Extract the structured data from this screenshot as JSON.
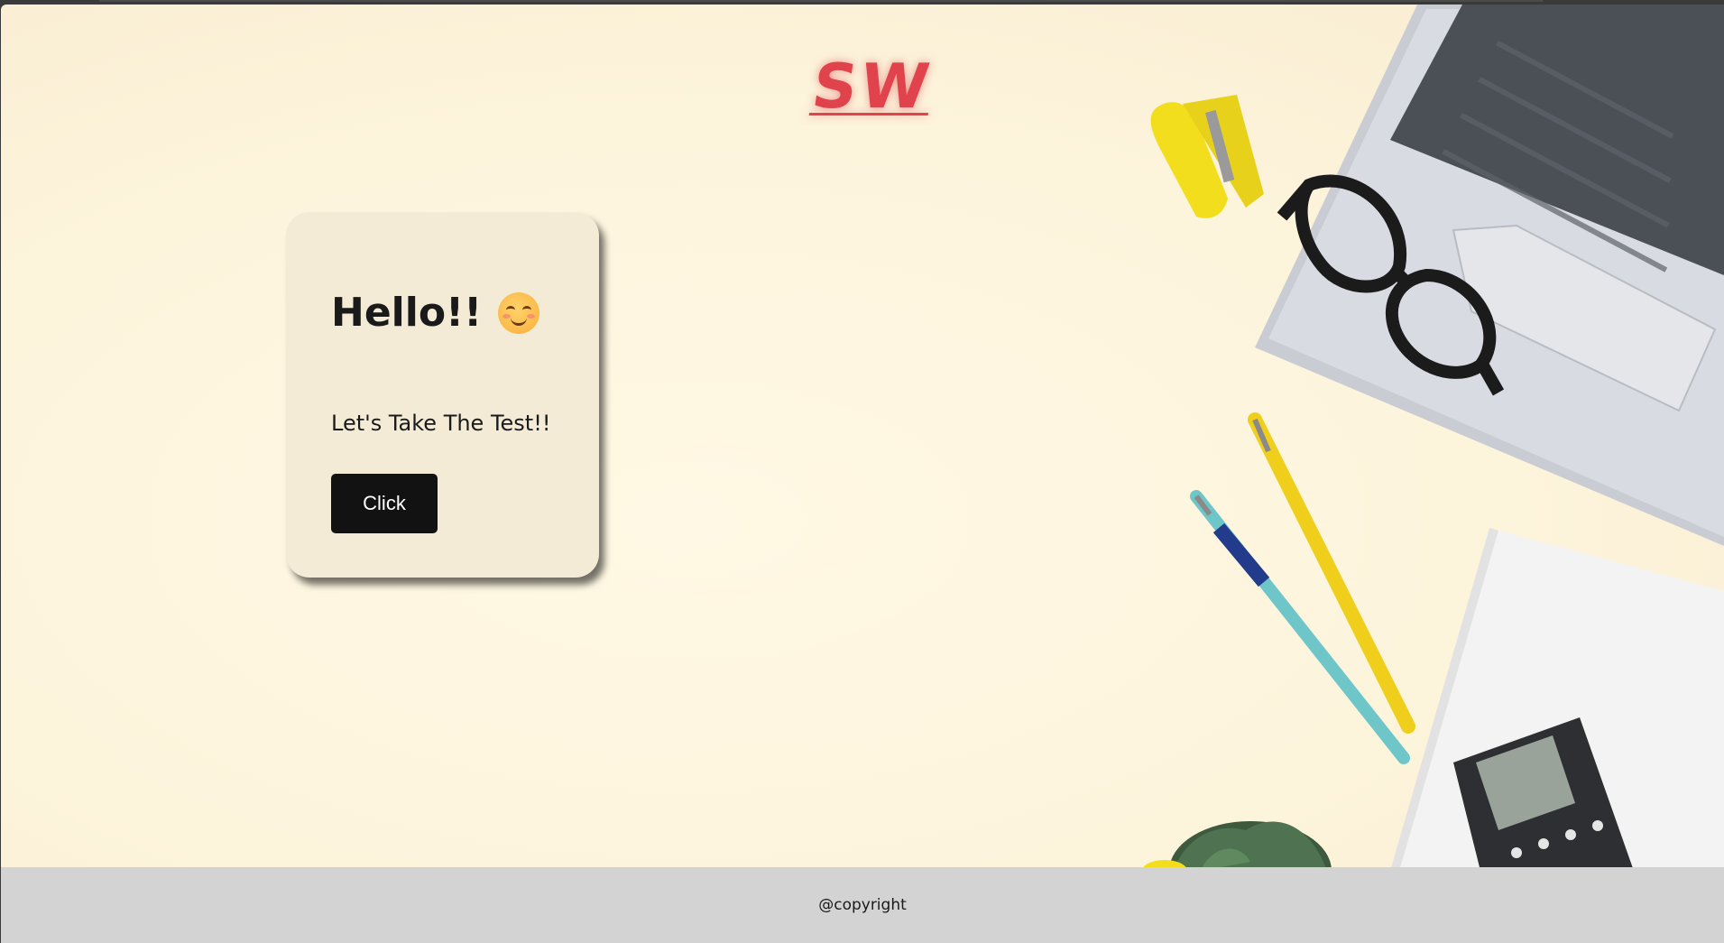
{
  "logo": {
    "text": "SW",
    "color": "#e0434b"
  },
  "card": {
    "title": "Hello!!",
    "emoji": "smiling-face-icon",
    "subtitle": "Let's Take The Test!!",
    "button_label": "Click"
  },
  "footer": {
    "text": "@copyright"
  },
  "background": {
    "color": "#fdf4dc",
    "photo_objects": [
      "laptop",
      "glasses",
      "stapler",
      "pens",
      "notebook",
      "calculator",
      "plant"
    ]
  }
}
